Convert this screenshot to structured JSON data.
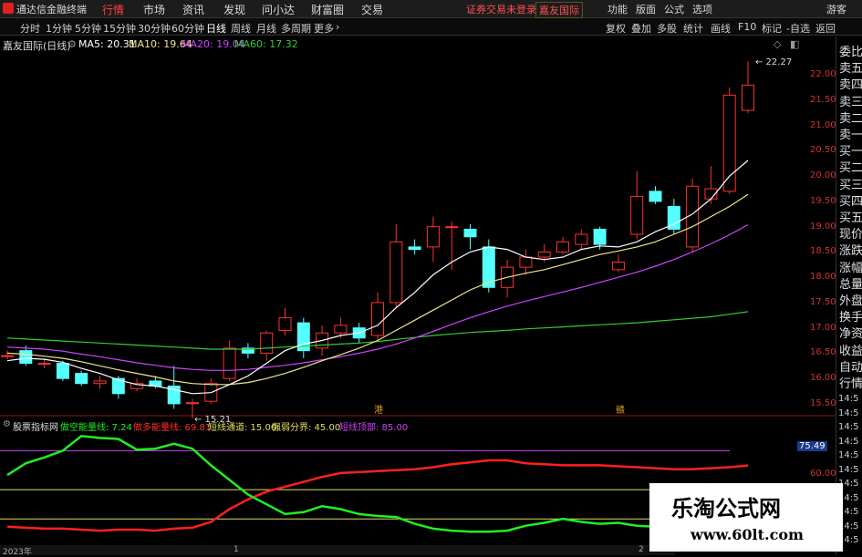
{
  "topbar": {
    "app_title": "通达信金融终端",
    "menus": [
      "行情",
      "市场",
      "资讯",
      "发现",
      "问小达",
      "财富圈",
      "交易"
    ],
    "active_menu": "行情",
    "notice": "证券交易未登录",
    "stock_tab": "嘉友国际",
    "right_menus": [
      "功能",
      "版面",
      "公式",
      "选项"
    ],
    "guest": "游客"
  },
  "periodbar": {
    "periods": [
      "分时",
      "1分钟",
      "5分钟",
      "15分钟",
      "30分钟",
      "60分钟",
      "日线",
      "周线",
      "月线",
      "多周期",
      "更多"
    ],
    "selected": "日线",
    "tools": [
      "复权",
      "叠加",
      "多股",
      "统计",
      "画线",
      "F10",
      "标记",
      "-自选",
      "返回"
    ]
  },
  "info": {
    "stock": "嘉友国际(日线)",
    "ma5": "MA5: 20.31",
    "ma10": "MA10: 19.64",
    "ma20": "MA20: 19.04",
    "ma60": "MA60: 17.32"
  },
  "sub": {
    "name": "股票指标网",
    "items": [
      "做空能量线: 7.24",
      "做多能量线: 69.81",
      "短线通道: 15.00",
      "强弱分界: 45.00",
      "短线顶部: 85.00"
    ],
    "values": {
      "short_energy": 7.24,
      "long_energy": 69.81,
      "channel": 15.0,
      "boundary": 45.0,
      "top": 85.0
    }
  },
  "annotations": {
    "high": "22.27",
    "low": "15.21",
    "marker1": "港",
    "marker2": "赣"
  },
  "yaxis": [
    "22.00",
    "21.50",
    "21.00",
    "20.50",
    "20.00",
    "19.50",
    "19.00",
    "18.50",
    "18.00",
    "17.50",
    "17.00",
    "16.50",
    "16.00",
    "15.50"
  ],
  "sub_yaxis": [
    "75.49",
    "60.00"
  ],
  "right_labels": [
    "委比",
    "卖五",
    "卖四",
    "卖三",
    "卖二",
    "卖一",
    "买一",
    "买二",
    "买三",
    "买四",
    "买五",
    "现价",
    "涨跌",
    "涨幅",
    "总量",
    "外盘",
    "换手",
    "净资",
    "收益",
    "自动",
    "行情"
  ],
  "right_times": [
    "14:5",
    "14:5",
    "14:5",
    "14:5",
    "14:5",
    "14:5",
    "14:5",
    "14:5",
    "14:5",
    "14:5",
    "14:5"
  ],
  "bottom": {
    "year": "2023年",
    "m1": "1",
    "m2": "2"
  },
  "watermark": {
    "title": "乐淘公式网",
    "url": "www.60lt.com"
  },
  "colors": {
    "up": "#ff3030",
    "down": "#54ffff",
    "ma5": "#ffffff",
    "ma10": "#f0e68c",
    "ma20": "#cc44ff",
    "ma60": "#33cc33",
    "long": "#ff2020",
    "short": "#22ee22"
  },
  "chart_data": {
    "type": "candlestick",
    "ylim": [
      15.3,
      22.4
    ],
    "candles": [
      {
        "o": 16.45,
        "c": 16.45,
        "h": 16.55,
        "l": 16.38
      },
      {
        "o": 16.55,
        "c": 16.3,
        "h": 16.65,
        "l": 16.25
      },
      {
        "o": 16.3,
        "c": 16.3,
        "h": 16.4,
        "l": 16.2
      },
      {
        "o": 16.3,
        "c": 16.0,
        "h": 16.35,
        "l": 15.95
      },
      {
        "o": 16.1,
        "c": 15.9,
        "h": 16.15,
        "l": 15.85
      },
      {
        "o": 15.9,
        "c": 15.95,
        "h": 16.05,
        "l": 15.8
      },
      {
        "o": 16.0,
        "c": 15.7,
        "h": 16.05,
        "l": 15.6
      },
      {
        "o": 15.8,
        "c": 15.9,
        "h": 16.0,
        "l": 15.75
      },
      {
        "o": 15.95,
        "c": 15.85,
        "h": 16.05,
        "l": 15.8
      },
      {
        "o": 15.85,
        "c": 15.5,
        "h": 16.25,
        "l": 15.4
      },
      {
        "o": 15.52,
        "c": 15.52,
        "h": 15.6,
        "l": 15.21
      },
      {
        "o": 15.55,
        "c": 15.9,
        "h": 16.0,
        "l": 15.5
      },
      {
        "o": 16.0,
        "c": 16.6,
        "h": 16.75,
        "l": 15.95
      },
      {
        "o": 16.6,
        "c": 16.5,
        "h": 16.7,
        "l": 16.4
      },
      {
        "o": 16.5,
        "c": 16.9,
        "h": 16.95,
        "l": 16.35
      },
      {
        "o": 16.95,
        "c": 17.2,
        "h": 17.4,
        "l": 16.85
      },
      {
        "o": 17.1,
        "c": 16.55,
        "h": 17.2,
        "l": 16.4
      },
      {
        "o": 16.6,
        "c": 16.9,
        "h": 17.05,
        "l": 16.45
      },
      {
        "o": 16.9,
        "c": 17.05,
        "h": 17.2,
        "l": 16.8
      },
      {
        "o": 17.0,
        "c": 16.8,
        "h": 17.1,
        "l": 16.7
      },
      {
        "o": 16.85,
        "c": 17.5,
        "h": 17.7,
        "l": 16.75
      },
      {
        "o": 17.5,
        "c": 18.7,
        "h": 19.05,
        "l": 17.4
      },
      {
        "o": 18.6,
        "c": 18.55,
        "h": 18.75,
        "l": 18.45
      },
      {
        "o": 18.6,
        "c": 19.0,
        "h": 19.2,
        "l": 18.3
      },
      {
        "o": 19.0,
        "c": 19.0,
        "h": 19.1,
        "l": 18.15
      },
      {
        "o": 18.95,
        "c": 18.8,
        "h": 19.05,
        "l": 18.55
      },
      {
        "o": 18.6,
        "c": 17.8,
        "h": 18.75,
        "l": 17.7
      },
      {
        "o": 17.8,
        "c": 18.2,
        "h": 18.35,
        "l": 17.6
      },
      {
        "o": 18.2,
        "c": 18.4,
        "h": 18.55,
        "l": 18.05
      },
      {
        "o": 18.4,
        "c": 18.5,
        "h": 18.65,
        "l": 18.3
      },
      {
        "o": 18.5,
        "c": 18.7,
        "h": 18.8,
        "l": 18.45
      },
      {
        "o": 18.65,
        "c": 18.85,
        "h": 18.95,
        "l": 18.55
      },
      {
        "o": 18.95,
        "c": 18.65,
        "h": 19.0,
        "l": 18.55
      },
      {
        "o": 18.15,
        "c": 18.3,
        "h": 18.45,
        "l": 18.1
      },
      {
        "o": 18.85,
        "c": 19.6,
        "h": 20.1,
        "l": 18.75
      },
      {
        "o": 19.7,
        "c": 19.5,
        "h": 19.8,
        "l": 19.45
      },
      {
        "o": 19.4,
        "c": 18.95,
        "h": 19.55,
        "l": 18.85
      },
      {
        "o": 18.6,
        "c": 19.8,
        "h": 19.95,
        "l": 18.5
      },
      {
        "o": 19.55,
        "c": 19.75,
        "h": 20.2,
        "l": 19.45
      },
      {
        "o": 19.7,
        "c": 21.6,
        "h": 21.75,
        "l": 19.65
      },
      {
        "o": 21.3,
        "c": 21.8,
        "h": 22.27,
        "l": 21.25
      }
    ],
    "ma5": [
      16.35,
      16.4,
      16.38,
      16.32,
      16.2,
      16.1,
      15.97,
      15.88,
      15.85,
      15.78,
      15.7,
      15.72,
      15.88,
      16.05,
      16.3,
      16.55,
      16.68,
      16.75,
      16.85,
      16.9,
      17.05,
      17.4,
      17.7,
      18.05,
      18.3,
      18.5,
      18.6,
      18.55,
      18.4,
      18.35,
      18.4,
      18.55,
      18.62,
      18.6,
      18.7,
      18.9,
      19.05,
      19.25,
      19.55,
      20.0,
      20.31
    ],
    "ma10": [
      16.5,
      16.48,
      16.44,
      16.4,
      16.33,
      16.25,
      16.17,
      16.1,
      16.03,
      15.95,
      15.9,
      15.88,
      15.88,
      15.92,
      16.0,
      16.1,
      16.22,
      16.35,
      16.47,
      16.6,
      16.75,
      16.95,
      17.15,
      17.35,
      17.55,
      17.75,
      17.9,
      18.0,
      18.08,
      18.15,
      18.25,
      18.35,
      18.45,
      18.52,
      18.6,
      18.7,
      18.85,
      19.0,
      19.2,
      19.4,
      19.64
    ],
    "ma20": [
      16.62,
      16.6,
      16.58,
      16.54,
      16.48,
      16.43,
      16.37,
      16.31,
      16.26,
      16.21,
      16.18,
      16.16,
      16.16,
      16.18,
      16.22,
      16.26,
      16.31,
      16.37,
      16.43,
      16.5,
      16.58,
      16.68,
      16.8,
      16.93,
      17.07,
      17.2,
      17.32,
      17.43,
      17.53,
      17.62,
      17.71,
      17.8,
      17.9,
      18.0,
      18.1,
      18.22,
      18.35,
      18.5,
      18.66,
      18.84,
      19.04
    ],
    "ma60": [
      16.8,
      16.78,
      16.76,
      16.74,
      16.72,
      16.7,
      16.68,
      16.66,
      16.64,
      16.62,
      16.6,
      16.58,
      16.58,
      16.58,
      16.6,
      16.62,
      16.64,
      16.66,
      16.68,
      16.7,
      16.73,
      16.77,
      16.81,
      16.85,
      16.88,
      16.91,
      16.93,
      16.95,
      16.98,
      17.0,
      17.02,
      17.04,
      17.06,
      17.08,
      17.1,
      17.13,
      17.16,
      17.19,
      17.22,
      17.27,
      17.32
    ],
    "sub_ylim": [
      -10,
      104
    ],
    "long_energy": [
      7,
      6,
      5,
      5,
      4,
      3,
      4,
      4,
      3,
      5,
      6,
      12,
      25,
      35,
      43,
      48,
      53,
      58,
      62,
      63,
      64,
      65,
      66,
      68,
      71,
      73,
      75,
      75,
      72,
      71,
      70,
      70,
      70,
      69,
      68,
      67,
      66,
      66,
      67,
      68,
      69.81
    ],
    "short_energy": [
      60,
      72,
      78,
      85,
      100,
      98,
      97,
      86,
      87,
      92,
      87,
      70,
      55,
      40,
      30,
      20,
      22,
      28,
      25,
      20,
      18,
      17,
      10,
      5,
      3,
      2,
      2,
      3,
      8,
      11,
      15,
      12,
      10,
      11,
      8,
      7,
      8,
      6,
      7,
      7,
      7.24
    ],
    "sub_levels": {
      "top": 85,
      "boundary": 45,
      "channel": 15
    }
  }
}
